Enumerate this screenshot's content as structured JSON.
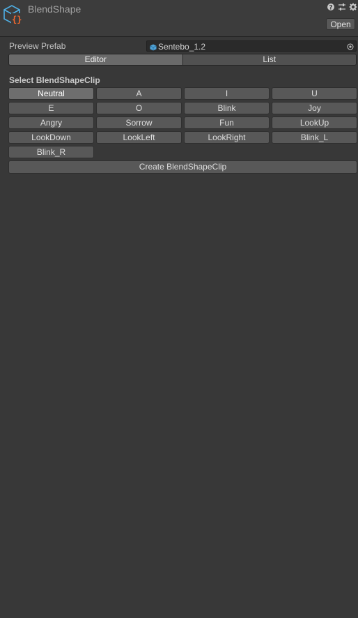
{
  "header": {
    "title": "BlendShape",
    "open_label": "Open",
    "icons": [
      "help-icon",
      "preset-icon",
      "settings-icon"
    ]
  },
  "preview_prefab": {
    "label": "Preview Prefab",
    "value": "Sentebo_1.2"
  },
  "tabs": [
    {
      "label": "Editor",
      "active": true
    },
    {
      "label": "List",
      "active": false
    }
  ],
  "clips": {
    "title": "Select BlendShapeClip",
    "selected": "Neutral",
    "items": [
      "Neutral",
      "A",
      "I",
      "U",
      "E",
      "O",
      "Blink",
      "Joy",
      "Angry",
      "Sorrow",
      "Fun",
      "LookUp",
      "LookDown",
      "LookLeft",
      "LookRight",
      "Blink_L",
      "Blink_R"
    ]
  },
  "create_label": "Create BlendShapeClip",
  "colors": {
    "background": "#383838",
    "accent_icon": "#4fb0e6",
    "accent_braces": "#f2682e"
  }
}
